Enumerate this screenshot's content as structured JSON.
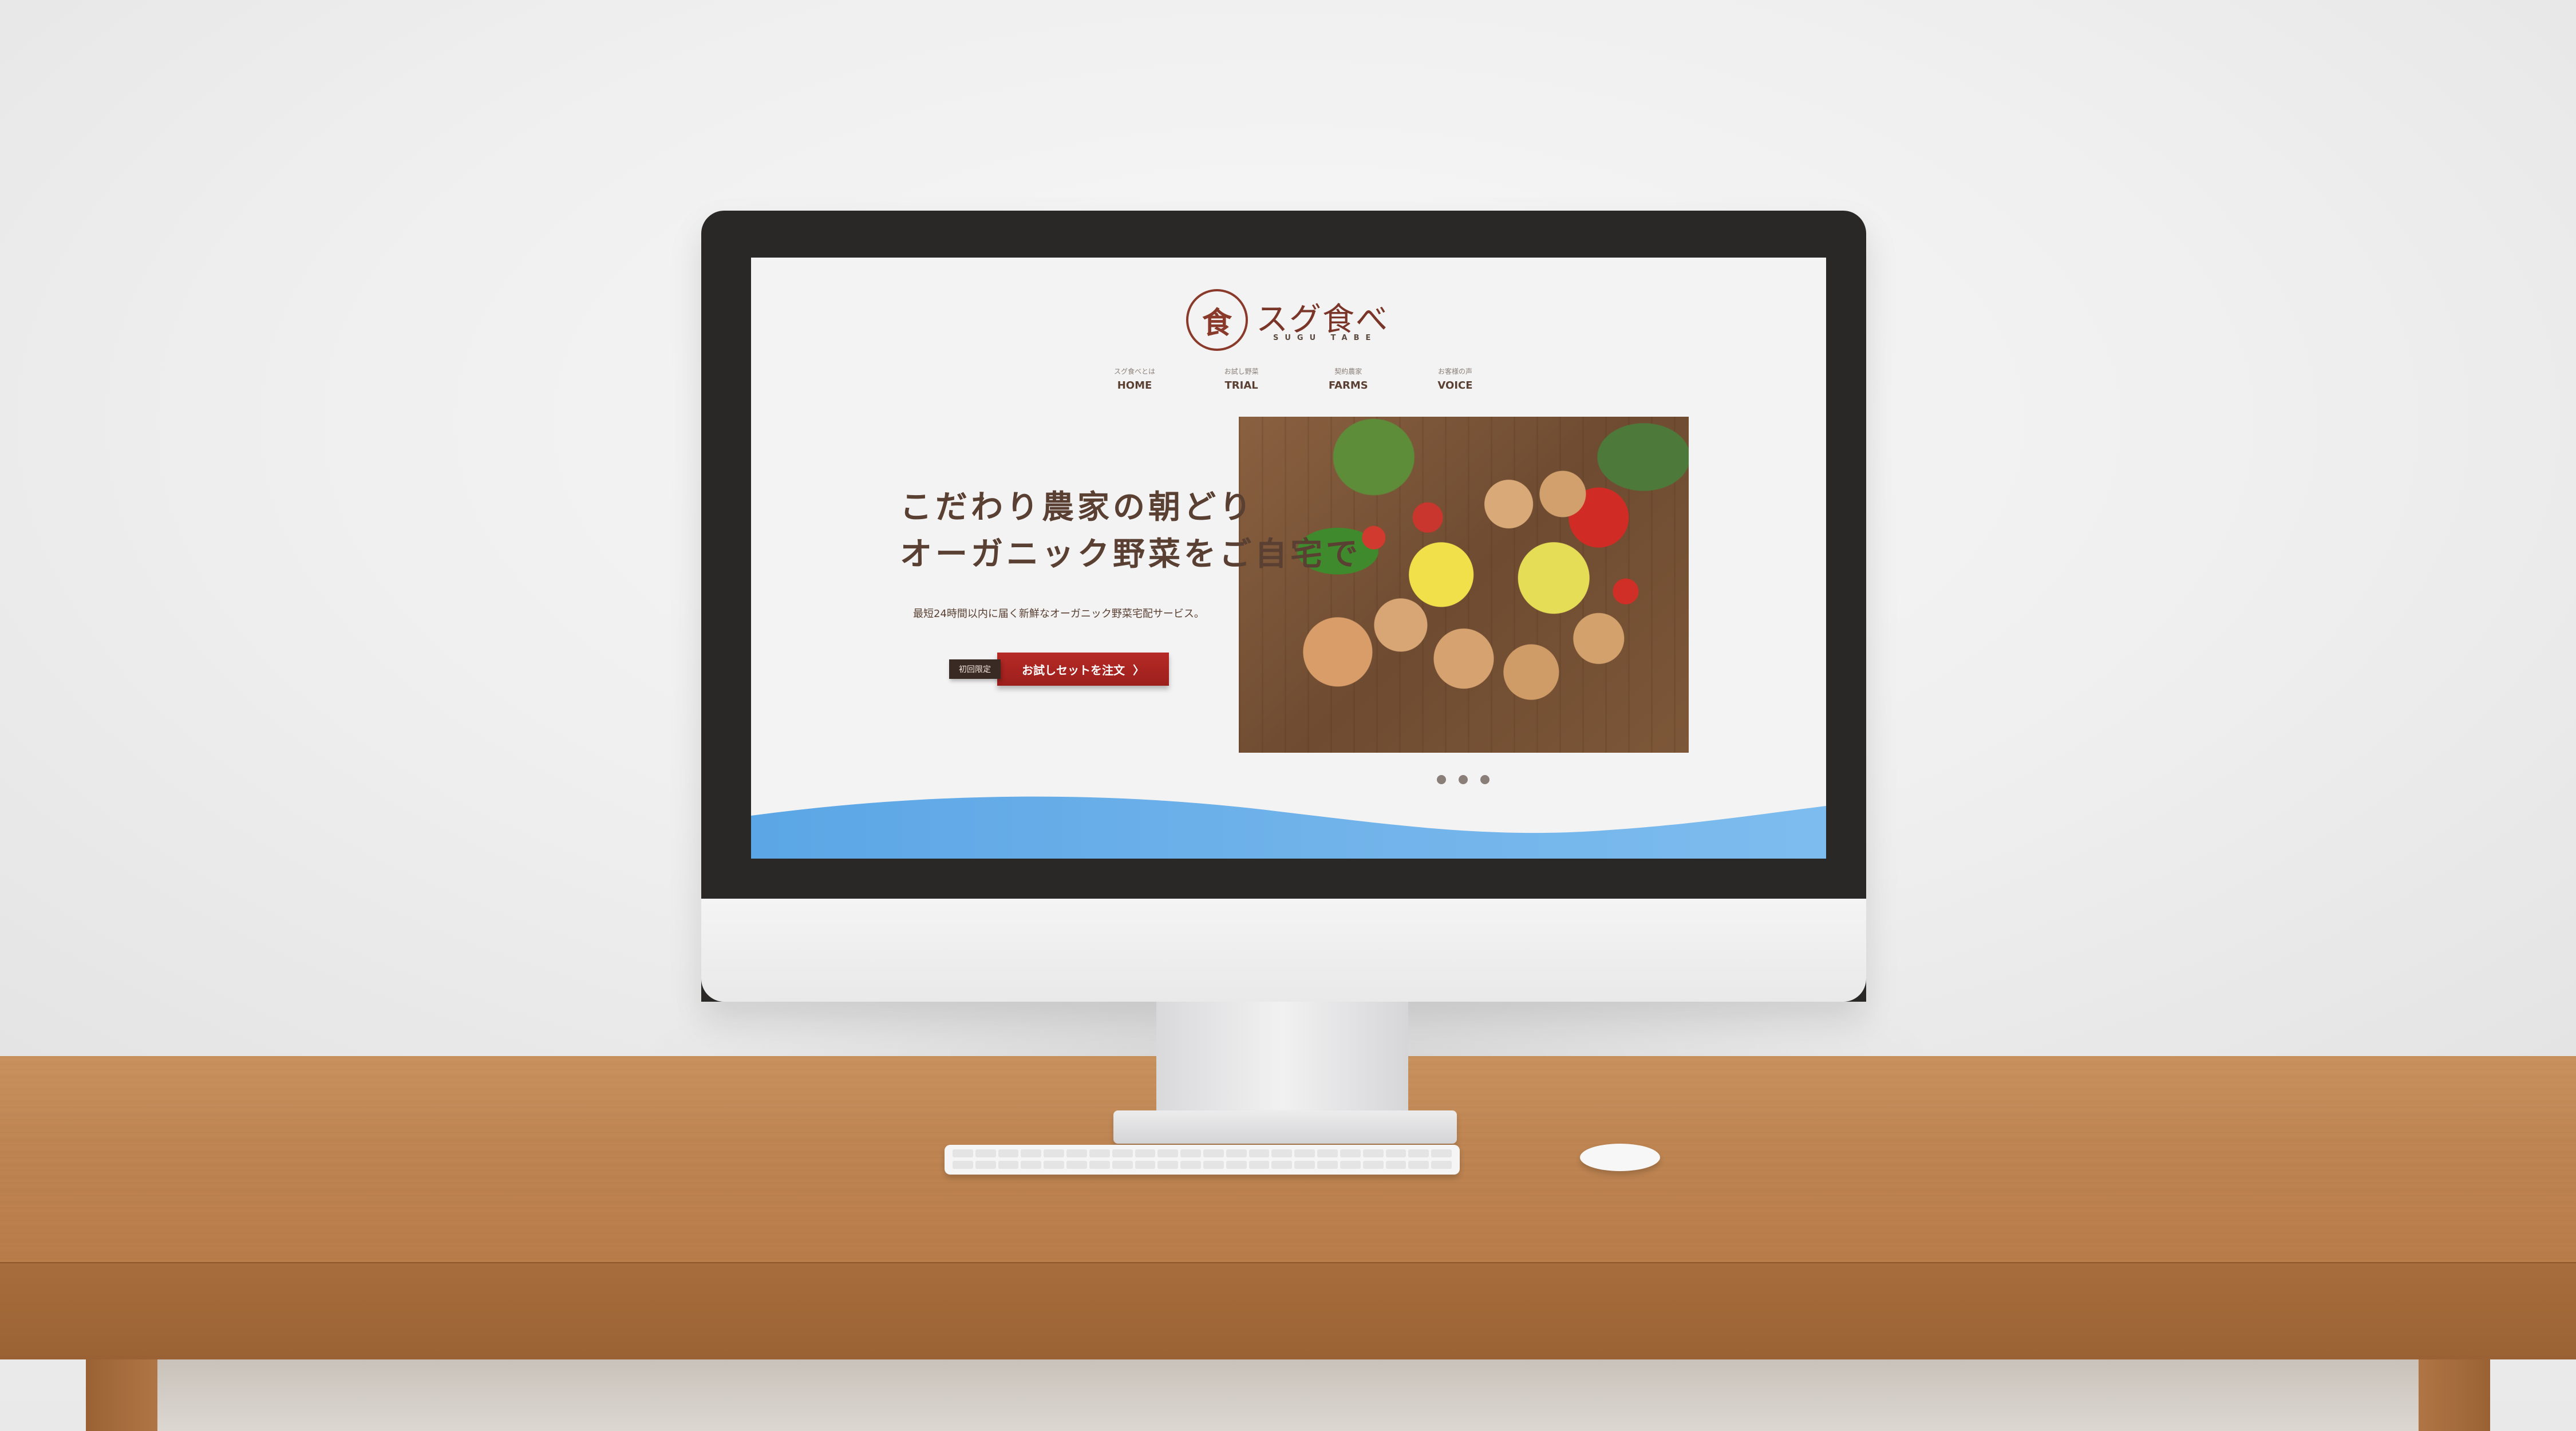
{
  "logo": {
    "mark": "食",
    "name": "スグ食べ",
    "sub": "SUGU TABE"
  },
  "nav": [
    {
      "sub": "スグ食べとは",
      "label": "HOME"
    },
    {
      "sub": "お試し野菜",
      "label": "TRIAL"
    },
    {
      "sub": "契約農家",
      "label": "FARMS"
    },
    {
      "sub": "お客様の声",
      "label": "VOICE"
    }
  ],
  "hero": {
    "title_line1": "こだわり農家の朝どり",
    "title_line2": "オーガニック野菜をご自宅で",
    "description": "最短24時間以内に届く新鮮なオーガニック野菜宅配サービス。",
    "cta_badge": "初回限定",
    "cta_label": "お試しセットを注文",
    "cta_arrow": "〉"
  },
  "slider": {
    "total": 3
  },
  "colors": {
    "brand": "#7a3529",
    "cta": "#b62a26",
    "wave": "#6fb2ea",
    "text": "#5a4032"
  },
  "icons": {
    "cta_arrow": "chevron-right-icon",
    "logo": "logo-mark-icon"
  }
}
